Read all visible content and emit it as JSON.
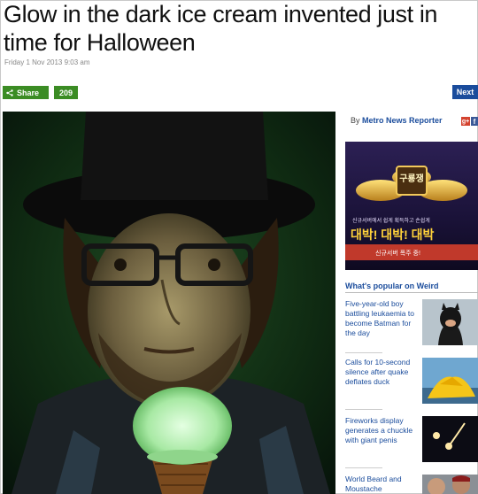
{
  "article": {
    "headline_line1": "Glow in the dark ice cream invented just in",
    "headline_line2": "time for Halloween",
    "dateline": "Friday 1 Nov 2013 9:03 am"
  },
  "toolbar": {
    "share_label": "Share",
    "share_count": "209",
    "next_label": "Next"
  },
  "sidebar": {
    "byline_prefix": "By",
    "byline_author": "Metro News Reporter",
    "social_icons": [
      "google-plus-icon",
      "facebook-icon"
    ],
    "ad": {
      "badge_text": "구룡쟁",
      "subtitle": "신규서버에서 쉽게 획득하고 손쉽게",
      "big_text": "대박! 대박! 대박",
      "bottom_text": "신규서버 폭주 중!"
    },
    "popular_title": "What's popular on Weird",
    "popular_items": [
      {
        "text": "Five-year-old boy battling leukaemia to become Batman for the day",
        "thumb": "batman-kid"
      },
      {
        "text": "Calls for 10-second silence after quake deflates duck",
        "thumb": "deflated-duck"
      },
      {
        "text": "Fireworks display generates a chuckle with giant penis",
        "thumb": "fireworks"
      },
      {
        "text": "World Beard and Moustache",
        "thumb": "beards"
      }
    ]
  },
  "colors": {
    "share_green": "#3b8c24",
    "next_blue": "#1a4c9c",
    "link_blue": "#1a4c9c"
  }
}
